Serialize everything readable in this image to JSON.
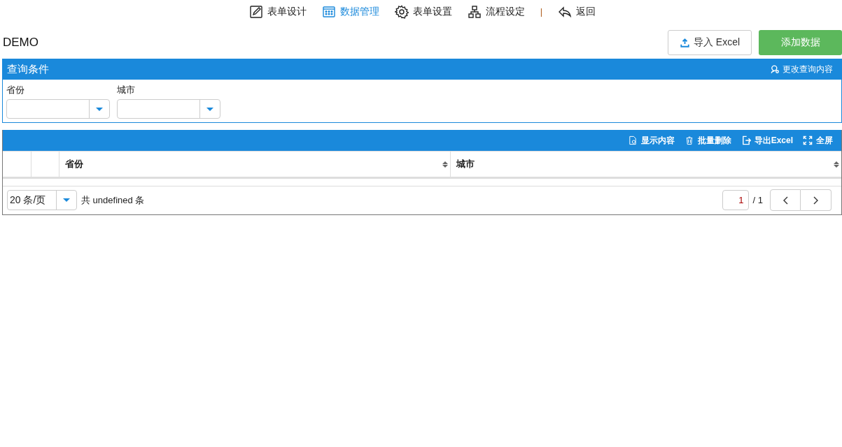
{
  "nav": [
    {
      "kind": "edit",
      "label": "表单设计",
      "selected": false
    },
    {
      "kind": "grid",
      "label": "数据管理",
      "selected": true
    },
    {
      "kind": "gear",
      "label": "表单设置",
      "selected": false
    },
    {
      "kind": "flow",
      "label": "流程设定",
      "selected": false
    },
    {
      "kind": "sep",
      "label": "|"
    },
    {
      "kind": "back",
      "label": "返回",
      "selected": false
    }
  ],
  "title": "DEMO",
  "actions": {
    "import": "导入 Excel",
    "add": "添加数据"
  },
  "query": {
    "title": "查询条件",
    "change": "更改查询内容",
    "fields": [
      {
        "label": "省份"
      },
      {
        "label": "城市"
      }
    ]
  },
  "table": {
    "tools": [
      {
        "kind": "doc",
        "label": "显示内容"
      },
      {
        "kind": "trash",
        "label": "批量删除"
      },
      {
        "kind": "export",
        "label": "导出Excel"
      },
      {
        "kind": "full",
        "label": "全屏"
      }
    ],
    "columns": [
      "省份",
      "城市"
    ]
  },
  "pager": {
    "page_size": "20 条/页",
    "total": "共 undefined 条",
    "page": "1",
    "pages": "/ 1"
  }
}
